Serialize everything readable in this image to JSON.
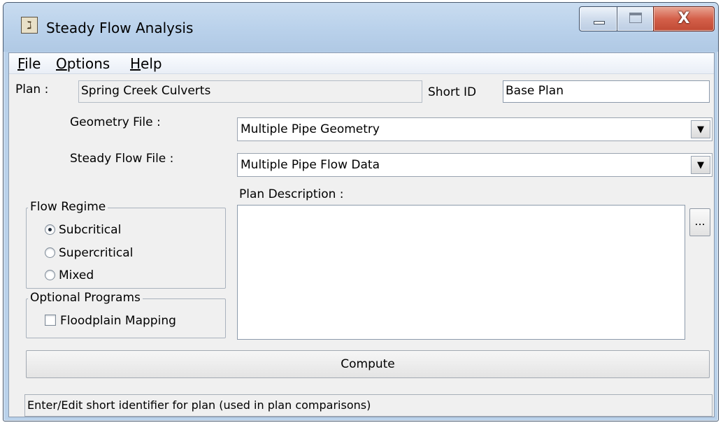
{
  "window": {
    "title": "Steady Flow Analysis",
    "app_icon_glyph": "ℷ",
    "controls": [
      "minimize-icon",
      "maximize-icon",
      "close-icon"
    ],
    "close_glyph": "X"
  },
  "menu": {
    "items": [
      {
        "mnemonic": "F",
        "rest": "ile"
      },
      {
        "mnemonic": "O",
        "rest": "ptions"
      },
      {
        "mnemonic": "H",
        "rest": "elp"
      }
    ]
  },
  "plan": {
    "label": "Plan :",
    "value": "Spring Creek Culverts",
    "short_id_label": "Short ID",
    "short_id_value": "Base Plan"
  },
  "geometry": {
    "label": "Geometry File :",
    "value": "Multiple Pipe Geometry"
  },
  "steady_flow": {
    "label": "Steady Flow File :",
    "value": "Multiple Pipe Flow Data"
  },
  "description": {
    "label": "Plan Description :",
    "value": "",
    "browse_label": "..."
  },
  "flow_regime": {
    "legend": "Flow Regime",
    "options": [
      {
        "label": "Subcritical",
        "checked": true
      },
      {
        "label": "Supercritical",
        "checked": false
      },
      {
        "label": "Mixed",
        "checked": false
      }
    ]
  },
  "optional_programs": {
    "legend": "Optional Programs",
    "floodplain_label": "Floodplain Mapping",
    "floodplain_checked": false
  },
  "compute_label": "Compute",
  "status": "Enter/Edit short identifier for plan (used in plan comparisons)",
  "colors": {
    "frame": "#b9d1ea",
    "client": "#f0f0f0",
    "close": "#c9503a"
  }
}
